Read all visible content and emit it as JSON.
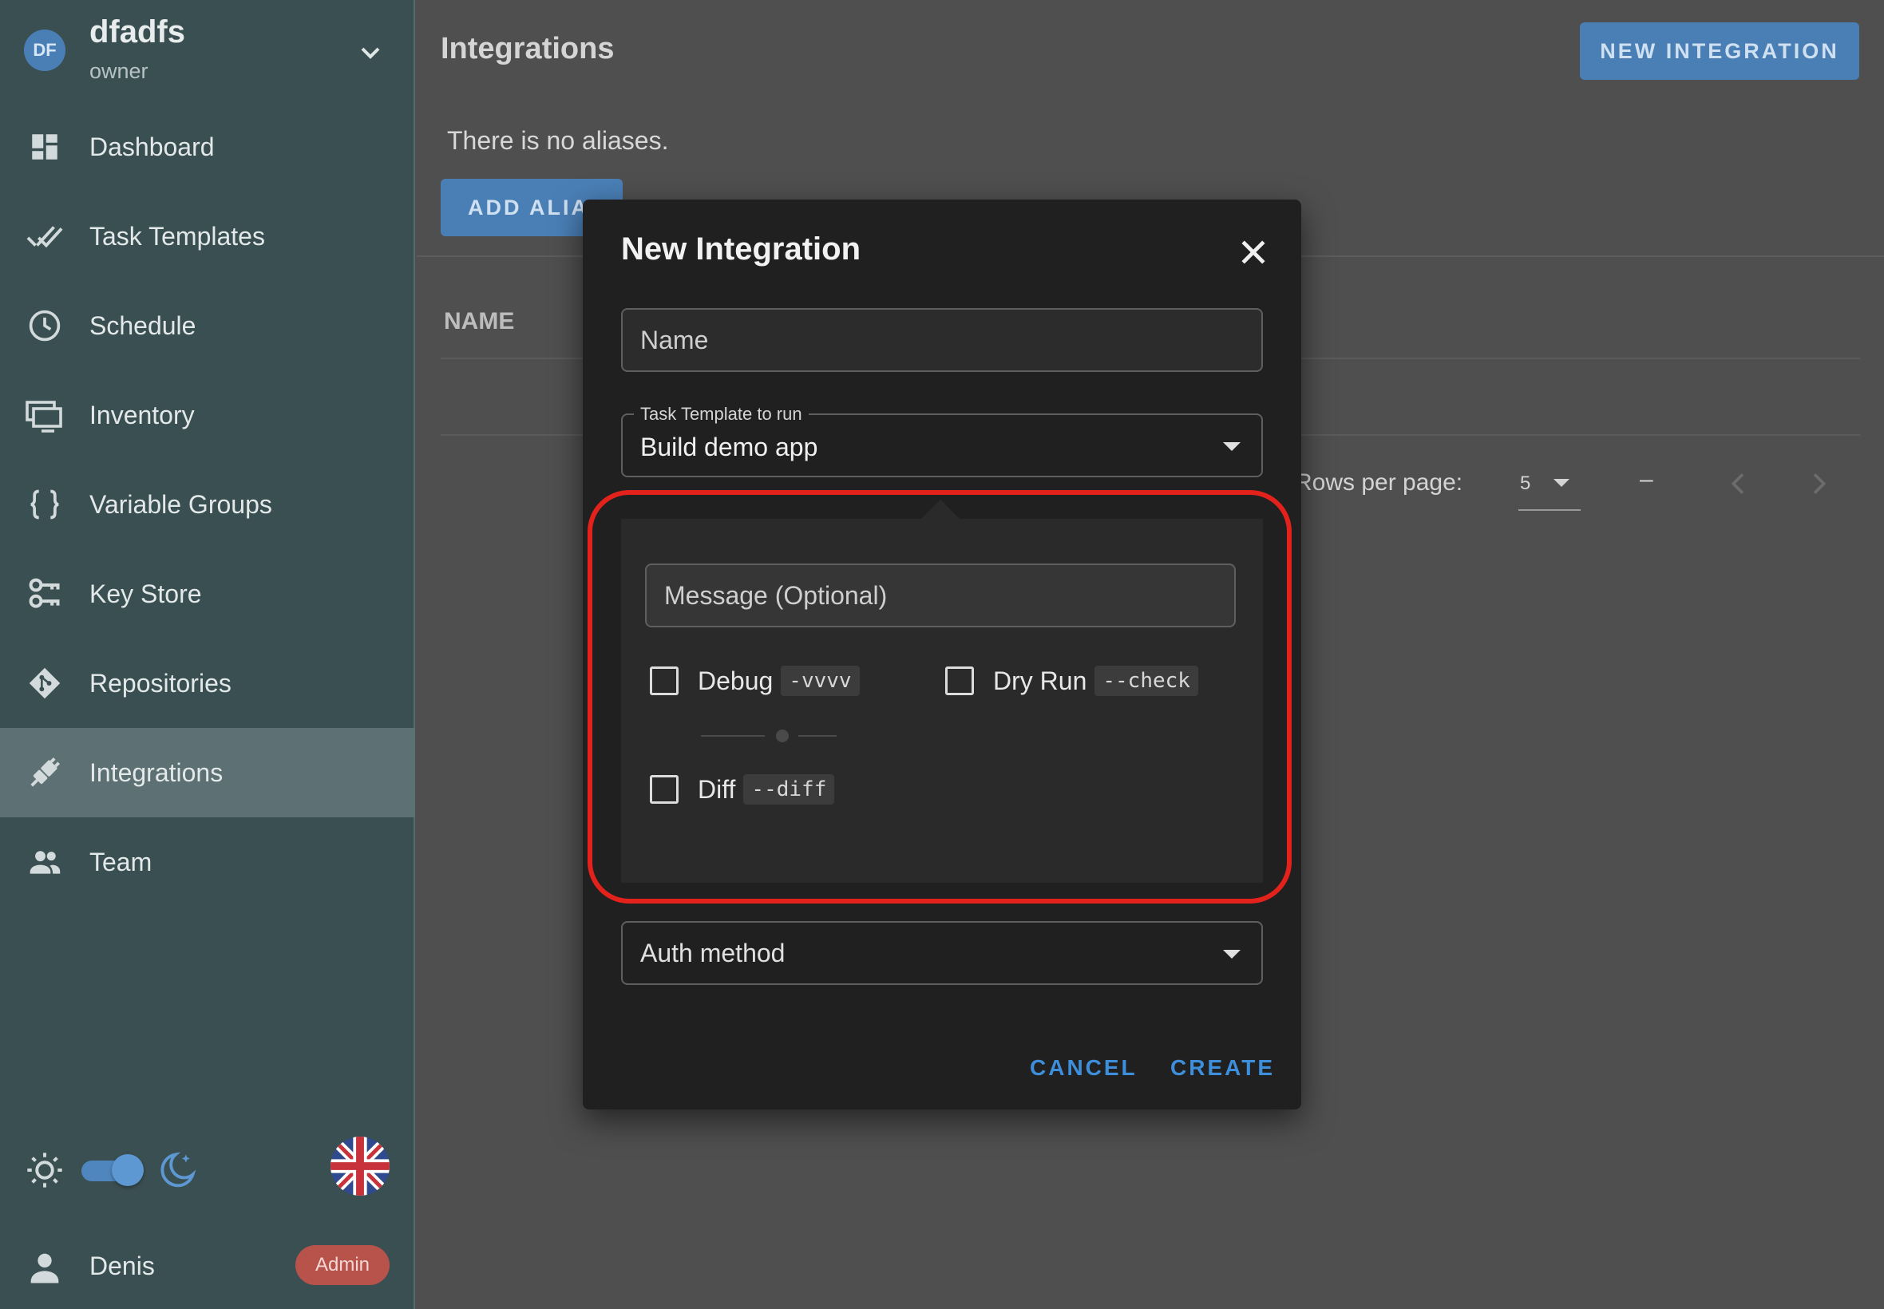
{
  "project": {
    "initials": "DF",
    "name": "dfadfs",
    "role": "owner"
  },
  "sidebar": {
    "items": [
      {
        "label": "Dashboard",
        "icon": "dashboard-icon"
      },
      {
        "label": "Task Templates",
        "icon": "double-check-icon"
      },
      {
        "label": "Schedule",
        "icon": "clock-icon"
      },
      {
        "label": "Inventory",
        "icon": "monitor-icon"
      },
      {
        "label": "Variable Groups",
        "icon": "braces-icon"
      },
      {
        "label": "Key Store",
        "icon": "keys-icon"
      },
      {
        "label": "Repositories",
        "icon": "git-icon"
      },
      {
        "label": "Integrations",
        "icon": "plug-icon",
        "active": true
      },
      {
        "label": "Team",
        "icon": "team-icon"
      }
    ]
  },
  "theme": {
    "dark_mode": true
  },
  "user": {
    "name": "Denis",
    "badge": "Admin"
  },
  "main": {
    "title": "Integrations",
    "new_button": "NEW INTEGRATION",
    "no_aliases": "There is no aliases.",
    "add_alias_button": "ADD ALIAS",
    "table": {
      "col_name": "NAME"
    },
    "pagination": {
      "rows_label": "Rows per page:",
      "rows_value": "5",
      "range": "–"
    }
  },
  "dialog": {
    "title": "New Integration",
    "name_placeholder": "Name",
    "template_label": "Task Template to run",
    "template_value": "Build demo app",
    "message_placeholder": "Message (Optional)",
    "options": {
      "debug": {
        "label": "Debug",
        "code": "-vvvv",
        "checked": false
      },
      "dry_run": {
        "label": "Dry Run",
        "code": "--check",
        "checked": false
      },
      "diff": {
        "label": "Diff",
        "code": "--diff",
        "checked": false
      }
    },
    "auth_placeholder": "Auth method",
    "cancel": "CANCEL",
    "create": "CREATE"
  },
  "colors": {
    "accent": "#3d8fdc",
    "primary_button": "#4a7fb6",
    "sidebar": "#3a4f52",
    "highlight": "#e3221c",
    "admin_badge": "#b8534b"
  }
}
